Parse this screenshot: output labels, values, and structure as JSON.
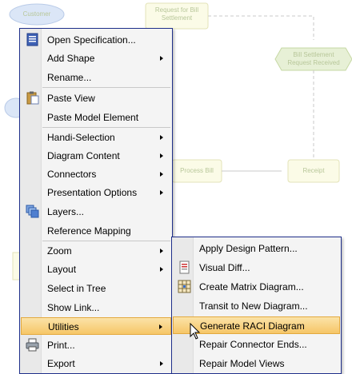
{
  "diagram": {
    "nodes": [
      {
        "name": "customer-node",
        "label": "Customer"
      },
      {
        "name": "request-node",
        "label": "Request for Bill Settlement"
      },
      {
        "name": "bill-received-node",
        "label": "Bill Settlement Request Received"
      },
      {
        "name": "process-bill-node",
        "label": "Process Bill"
      },
      {
        "name": "receipt-node",
        "label": "Receipt"
      }
    ]
  },
  "main_menu": {
    "items": [
      {
        "label": "Open Specification...",
        "icon": "specification-icon",
        "submenu": false
      },
      {
        "label": "Add Shape",
        "submenu": true
      },
      {
        "label": "Rename...",
        "submenu": false
      },
      {
        "label": "Paste View",
        "icon": "paste-icon",
        "submenu": false
      },
      {
        "label": "Paste Model Element",
        "submenu": false
      },
      {
        "label": "Handi-Selection",
        "submenu": true
      },
      {
        "label": "Diagram Content",
        "submenu": true
      },
      {
        "label": "Connectors",
        "submenu": true
      },
      {
        "label": "Presentation Options",
        "submenu": true
      },
      {
        "label": "Layers...",
        "icon": "layers-icon",
        "submenu": false
      },
      {
        "label": "Reference Mapping",
        "submenu": false
      },
      {
        "label": "Zoom",
        "submenu": true
      },
      {
        "label": "Layout",
        "submenu": true
      },
      {
        "label": "Select in Tree",
        "submenu": false
      },
      {
        "label": "Show Link...",
        "submenu": false
      },
      {
        "label": "Utilities",
        "submenu": true,
        "highlighted": true
      },
      {
        "label": "Print...",
        "icon": "printer-icon",
        "submenu": false
      },
      {
        "label": "Export",
        "submenu": true
      }
    ]
  },
  "utilities_menu": {
    "items": [
      {
        "label": "Apply Design Pattern..."
      },
      {
        "label": "Visual Diff...",
        "icon": "visual-diff-icon"
      },
      {
        "label": "Create Matrix Diagram...",
        "icon": "matrix-icon"
      },
      {
        "label": "Transit to New Diagram..."
      },
      {
        "label": "Generate RACI Diagram",
        "highlighted": true
      },
      {
        "label": "Repair Connector Ends..."
      },
      {
        "label": "Repair Model Views"
      }
    ]
  },
  "colors": {
    "menu_border": "#1f2f8a",
    "highlight": "#f6c667",
    "diagram_faded": "#d9e6bd"
  }
}
